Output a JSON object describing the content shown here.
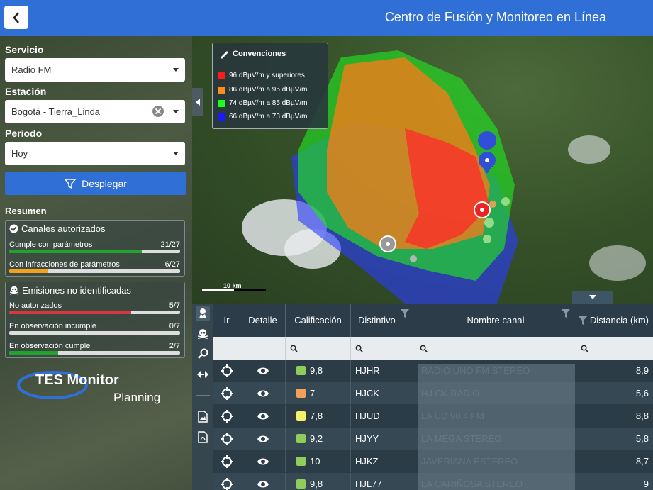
{
  "header": {
    "title": "Centro de Fusión y Monitoreo en Línea"
  },
  "sidebar": {
    "servicio_label": "Servicio",
    "servicio_value": "Radio FM",
    "estacion_label": "Estación",
    "estacion_value": "Bogotá - Tierra_Linda",
    "periodo_label": "Periodo",
    "periodo_value": "Hoy",
    "desplegar_label": "Desplegar",
    "resumen_label": "Resumen",
    "canales": {
      "title": "Canales autorizados",
      "rows": [
        {
          "label": "Cumple con parámetros",
          "count": "21/27",
          "fraction": 0.777,
          "color": "#22a32b"
        },
        {
          "label": "Con infracciones de parámetros",
          "count": "6/27",
          "fraction": 0.222,
          "color": "#f2a31b"
        }
      ]
    },
    "emisiones": {
      "title": "Emisiones no identificadas",
      "rows": [
        {
          "label": "No autorizados",
          "count": "5/7",
          "fraction": 0.714,
          "color": "#d9363e"
        },
        {
          "label": "En observación incumple",
          "count": "0/7",
          "fraction": 0.0,
          "color": "#d9363e"
        },
        {
          "label": "En observación cumple",
          "count": "2/7",
          "fraction": 0.285,
          "color": "#22a32b"
        }
      ]
    },
    "logo": {
      "line1": "TES Monitor",
      "line2": "Planning"
    }
  },
  "map": {
    "legend_title": "Convenciones",
    "legend": [
      {
        "label": "96 dBµV/m y superiores",
        "color": "#ff1a1a"
      },
      {
        "label": "86 dBµV/m a 95 dBµV/m",
        "color": "#ff8c1a"
      },
      {
        "label": "74 dBµV/m a 85 dBµV/m",
        "color": "#1aff1a"
      },
      {
        "label": "66 dBµV/m a 73 dBµV/m",
        "color": "#1a1aff"
      }
    ],
    "scale_label": "10 km"
  },
  "table": {
    "headers": {
      "ir": "Ir",
      "detalle": "Detalle",
      "calificacion": "Calificación",
      "distintivo": "Distintivo",
      "nombre": "Nombre canal",
      "distancia": "Distancia (km)"
    },
    "rows": [
      {
        "calificacion": "9,8",
        "color": "#8fcd5a",
        "distintivo": "HJHR",
        "nombre": "RADIO UNO FM STEREO",
        "distancia": "8,9"
      },
      {
        "calificacion": "7",
        "color": "#f4a05a",
        "distintivo": "HJCK",
        "nombre": "HJ CK RADIO",
        "distancia": "5,6"
      },
      {
        "calificacion": "7,8",
        "color": "#f6ef6a",
        "distintivo": "HJUD",
        "nombre": "LA UD 90.4 FM",
        "distancia": "8,8"
      },
      {
        "calificacion": "9,2",
        "color": "#8fcd5a",
        "distintivo": "HJYY",
        "nombre": "LA MEGA STEREO",
        "distancia": "5,8"
      },
      {
        "calificacion": "10",
        "color": "#8fcd5a",
        "distintivo": "HJKZ",
        "nombre": "JAVERIANA ESTEREO",
        "distancia": "8,7"
      },
      {
        "calificacion": "9,8",
        "color": "#8fcd5a",
        "distintivo": "HJL77",
        "nombre": "LA CARIÑOSA STEREO",
        "distancia": "9"
      }
    ]
  }
}
